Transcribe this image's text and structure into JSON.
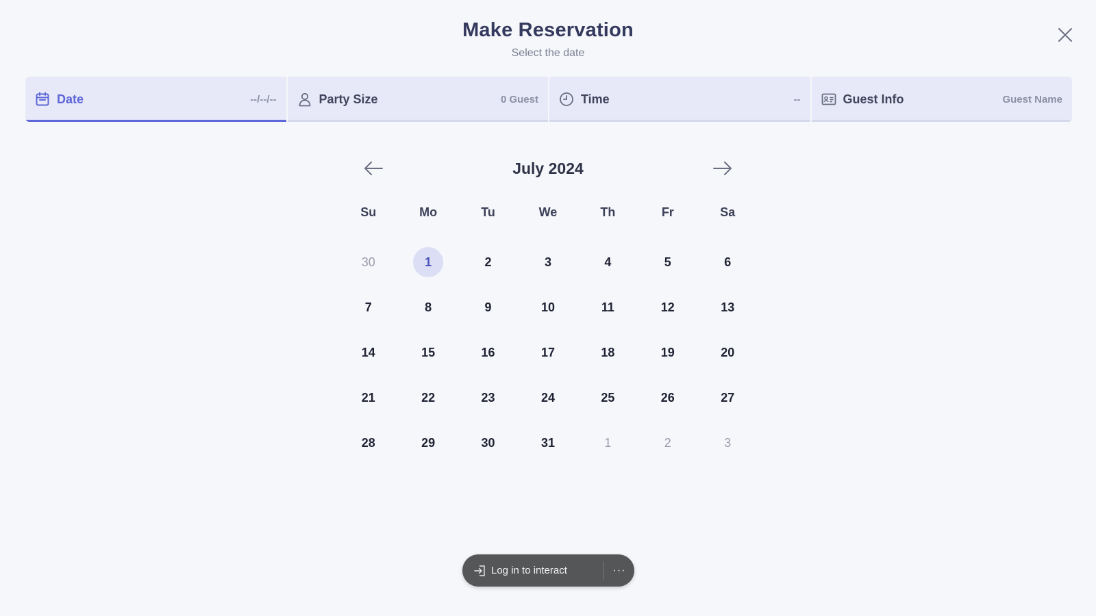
{
  "header": {
    "title": "Make Reservation",
    "subtitle": "Select the date"
  },
  "steps": [
    {
      "icon": "calendar-icon",
      "label": "Date",
      "value": "--/--/--",
      "active": true
    },
    {
      "icon": "person-icon",
      "label": "Party Size",
      "value": "0 Guest",
      "active": false
    },
    {
      "icon": "clock-icon",
      "label": "Time",
      "value": "--",
      "active": false
    },
    {
      "icon": "id-card-icon",
      "label": "Guest Info",
      "value": "Guest Name",
      "active": false
    }
  ],
  "calendar": {
    "month_label": "July 2024",
    "weekdays": [
      "Su",
      "Mo",
      "Tu",
      "We",
      "Th",
      "Fr",
      "Sa"
    ],
    "days": [
      {
        "n": "30",
        "muted": true
      },
      {
        "n": "1",
        "today": true
      },
      {
        "n": "2"
      },
      {
        "n": "3"
      },
      {
        "n": "4"
      },
      {
        "n": "5"
      },
      {
        "n": "6"
      },
      {
        "n": "7"
      },
      {
        "n": "8"
      },
      {
        "n": "9"
      },
      {
        "n": "10"
      },
      {
        "n": "11"
      },
      {
        "n": "12"
      },
      {
        "n": "13"
      },
      {
        "n": "14"
      },
      {
        "n": "15"
      },
      {
        "n": "16"
      },
      {
        "n": "17"
      },
      {
        "n": "18"
      },
      {
        "n": "19"
      },
      {
        "n": "20"
      },
      {
        "n": "21"
      },
      {
        "n": "22"
      },
      {
        "n": "23"
      },
      {
        "n": "24"
      },
      {
        "n": "25"
      },
      {
        "n": "26"
      },
      {
        "n": "27"
      },
      {
        "n": "28"
      },
      {
        "n": "29"
      },
      {
        "n": "30"
      },
      {
        "n": "31"
      },
      {
        "n": "1",
        "muted": true
      },
      {
        "n": "2",
        "muted": true
      },
      {
        "n": "3",
        "muted": true
      }
    ]
  },
  "login_bar": {
    "label": "Log in to interact",
    "more": "···"
  },
  "colors": {
    "accent": "#5e67d9",
    "step_bg": "#e7e9f8",
    "today_bg": "#dcdef6",
    "page_bg": "#f6f7fa"
  }
}
